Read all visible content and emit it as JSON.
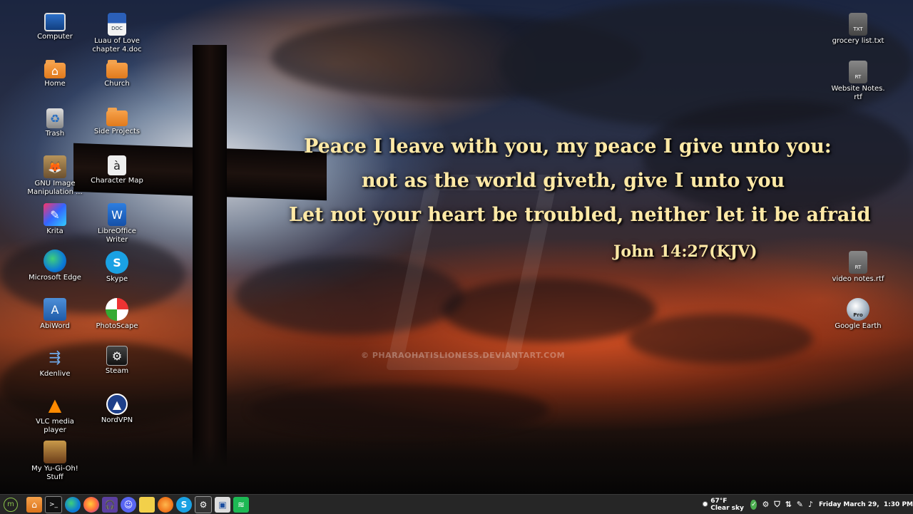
{
  "desktop": {
    "icons_left": [
      {
        "label": "Computer"
      },
      {
        "label": "Luau of Love chapter 4.doc",
        "badge": "DOC"
      },
      {
        "label": "Home"
      },
      {
        "label": "Church"
      },
      {
        "label": "Trash"
      },
      {
        "label": "Side Projects"
      },
      {
        "label": "GNU Image Manipulation ..."
      },
      {
        "label": "Character Map",
        "glyph": "à"
      },
      {
        "label": "Krita"
      },
      {
        "label": "LibreOffice Writer"
      },
      {
        "label": "Microsoft Edge"
      },
      {
        "label": "Skype"
      },
      {
        "label": "AbiWord"
      },
      {
        "label": "PhotoScape"
      },
      {
        "label": "Kdenlive"
      },
      {
        "label": "Steam"
      },
      {
        "label": "VLC media player"
      },
      {
        "label": "NordVPN"
      },
      {
        "label": "My Yu-Gi-Oh! Stuff"
      }
    ],
    "icons_right": [
      {
        "label": "grocery list.txt",
        "badge": "TXT"
      },
      {
        "label": "Website Notes. rtf",
        "badge": "RT"
      },
      {
        "label": "video notes.rtf",
        "badge": "RT"
      },
      {
        "label": "Google Earth",
        "badge": "Pro"
      }
    ]
  },
  "wallpaper": {
    "verse_lines": [
      "Peace I leave with you, my peace I give unto you:",
      "not as the world giveth, give I unto you",
      "Let not your heart be troubled, neither let it be afraid"
    ],
    "reference": "John 14:27(KJV)",
    "watermark": "© PHARAOHATISLIONESS.DEVIANTART.COM"
  },
  "taskbar": {
    "apps": [
      "menu-icon",
      "files-icon",
      "terminal-icon",
      "edge-icon",
      "firefox-icon",
      "headphones-icon",
      "discord-icon",
      "notes-icon",
      "avatar-icon",
      "skype-icon",
      "steam-icon",
      "display-icon",
      "spotify-icon"
    ],
    "weather": "67°F Clear sky",
    "clock": "Friday March 29,  1:30 PM"
  },
  "colors": {
    "verse_text": "#ffe9a6",
    "taskbar": "#262626"
  }
}
